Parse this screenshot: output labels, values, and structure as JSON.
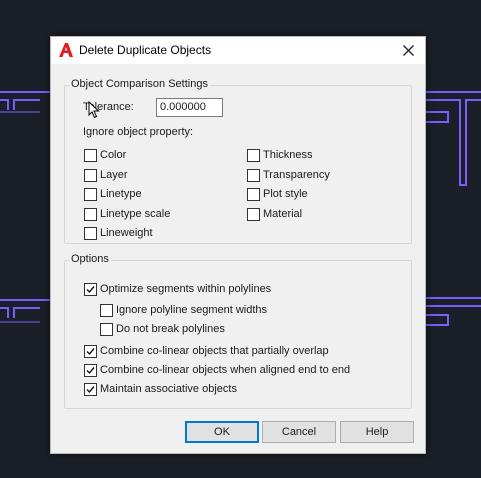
{
  "dialog": {
    "title": "Delete Duplicate Objects",
    "app_icon": "autocad-logo-icon",
    "close_icon": "close-icon"
  },
  "comparison": {
    "legend": "Object Comparison Settings",
    "tolerance_label": "Tolerance:",
    "tolerance_value": "0.000000",
    "ignore_label": "Ignore object property:",
    "properties": [
      {
        "label": "Color",
        "checked": false
      },
      {
        "label": "Layer",
        "checked": false
      },
      {
        "label": "Linetype",
        "checked": false
      },
      {
        "label": "Linetype scale",
        "checked": false
      },
      {
        "label": "Lineweight",
        "checked": false
      },
      {
        "label": "Thickness",
        "checked": false
      },
      {
        "label": "Transparency",
        "checked": false
      },
      {
        "label": "Plot style",
        "checked": false
      },
      {
        "label": "Material",
        "checked": false
      }
    ]
  },
  "options": {
    "legend": "Options",
    "items": [
      {
        "label": "Optimize segments within polylines",
        "checked": true
      },
      {
        "label": "Ignore polyline segment widths",
        "checked": false
      },
      {
        "label": "Do not break polylines",
        "checked": false
      },
      {
        "label": "Combine co-linear objects that partially overlap",
        "checked": true
      },
      {
        "label": "Combine co-linear objects when aligned end to end",
        "checked": true
      },
      {
        "label": "Maintain associative objects",
        "checked": true
      }
    ]
  },
  "buttons": {
    "ok": "OK",
    "cancel": "Cancel",
    "help": "Help"
  },
  "colors": {
    "background": "#1b2028",
    "drawing_lines": "#7b5cff",
    "focus_border": "#0078d7"
  }
}
